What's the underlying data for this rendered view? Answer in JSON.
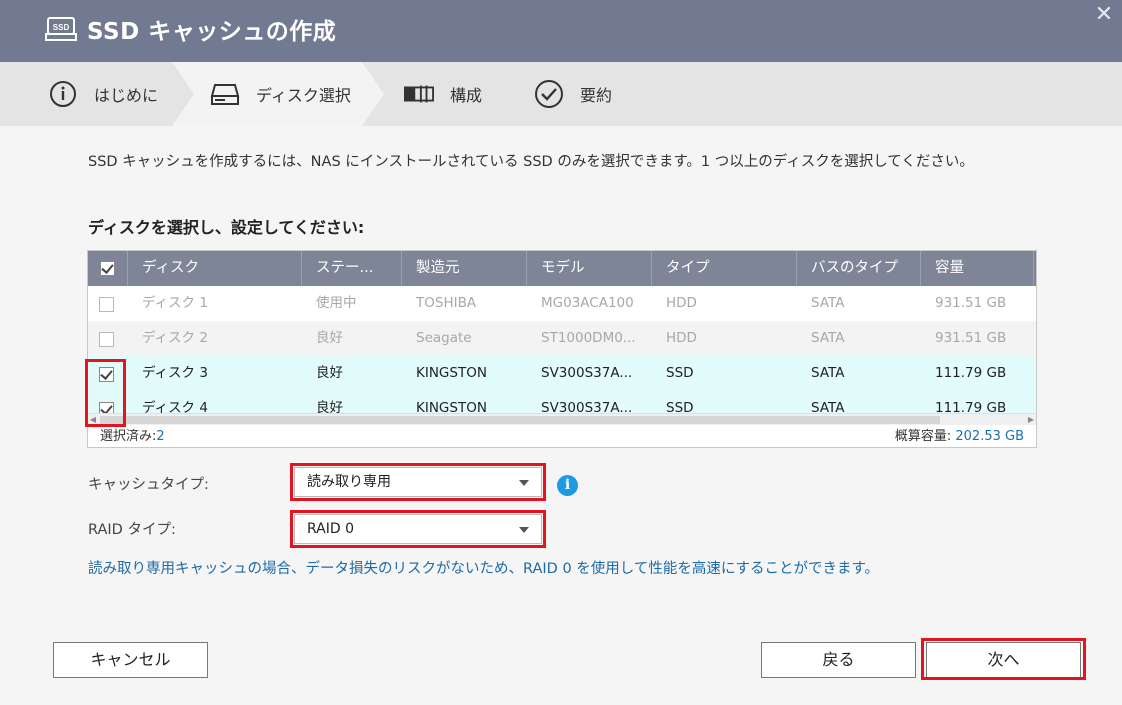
{
  "window": {
    "title": "SSD キャッシュの作成",
    "close_glyph": "✕",
    "title_icon_text": "SSD"
  },
  "steps": [
    {
      "label": "はじめに",
      "icon": "info-circle-icon"
    },
    {
      "label": "ディスク選択",
      "icon": "disk-drive-icon"
    },
    {
      "label": "構成",
      "icon": "raid-config-icon"
    },
    {
      "label": "要約",
      "icon": "check-circle-icon"
    }
  ],
  "intro": "SSD キャッシュを作成するには、NAS にインストールされている SSD のみを選択できます。1 つ以上のディスクを選択してください。",
  "section_title": "ディスクを選択し、設定してください:",
  "table": {
    "columns": [
      "ディスク",
      "ステー...",
      "製造元",
      "モデル",
      "タイプ",
      "バスのタイプ",
      "容量"
    ],
    "rows": [
      {
        "disk": "ディスク 1",
        "status": "使用中",
        "maker": "TOSHIBA",
        "model": "MG03ACA100",
        "type": "HDD",
        "bus": "SATA",
        "capacity": "931.51 GB",
        "checked": false,
        "enabled": false
      },
      {
        "disk": "ディスク 2",
        "status": "良好",
        "maker": "Seagate",
        "model": "ST1000DM0...",
        "type": "HDD",
        "bus": "SATA",
        "capacity": "931.51 GB",
        "checked": false,
        "enabled": false
      },
      {
        "disk": "ディスク 3",
        "status": "良好",
        "maker": "KINGSTON",
        "model": "SV300S37A...",
        "type": "SSD",
        "bus": "SATA",
        "capacity": "111.79 GB",
        "checked": true,
        "enabled": true
      },
      {
        "disk": "ディスク 4",
        "status": "良好",
        "maker": "KINGSTON",
        "model": "SV300S37A...",
        "type": "SSD",
        "bus": "SATA",
        "capacity": "111.79 GB",
        "checked": true,
        "enabled": true
      }
    ],
    "footer_selected_label": "選択済み:",
    "footer_selected_count": "2",
    "footer_capacity_label": "概算容量:",
    "footer_capacity_value": "202.53 GB"
  },
  "form": {
    "cache_type_label": "キャッシュタイプ:",
    "cache_type_value": "読み取り専用",
    "raid_type_label": "RAID タイプ:",
    "raid_type_value": "RAID 0",
    "info_glyph": "i",
    "note": "読み取り専用キャッシュの場合、データ損失のリスクがないため、RAID 0 を使用して性能を高速にすることができます。"
  },
  "buttons": {
    "cancel": "キャンセル",
    "back": "戻る",
    "next": "次へ"
  },
  "colors": {
    "titlebar": "#717a90",
    "table_header": "#7d8597",
    "selected_row": "#e2fbfb",
    "highlight": "#e1141f",
    "link": "#1e6aa6",
    "info": "#1e9be0"
  }
}
